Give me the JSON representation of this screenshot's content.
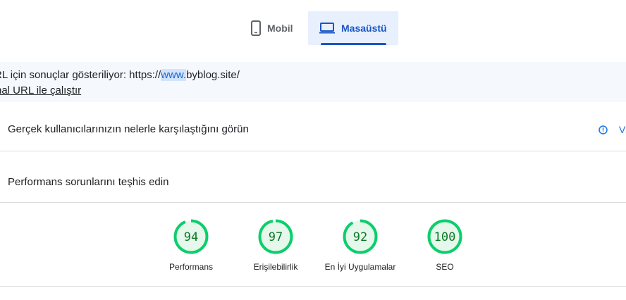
{
  "tabs": [
    {
      "label": "Mobil",
      "icon": "smartphone-icon",
      "selected": false
    },
    {
      "label": "Masaüstü",
      "icon": "laptop-icon",
      "selected": true
    }
  ],
  "url_banner": {
    "prefix": "RL için sonuçlar gösteriliyor: https://",
    "highlight": "www.",
    "suffix": "byblog.site/",
    "original_link": "ijinal URL ile çalıştır"
  },
  "field_data": {
    "heading": "Gerçek kullanıcılarınızın nelerle karşılaştığını görün",
    "info_label": "V",
    "info_icon": "info-icon"
  },
  "lab": {
    "heading": "Performans sorunlarını teşhis edin",
    "scores": [
      {
        "label": "Performans",
        "value": 94
      },
      {
        "label": "Erişilebilirlik",
        "value": 97
      },
      {
        "label": "En İyi Uygulamalar",
        "value": 92
      },
      {
        "label": "SEO",
        "value": 100
      }
    ]
  },
  "colors": {
    "accent": "#1a56c4",
    "good": "#0cce6b",
    "good_text": "#0a7a25",
    "good_bg": "#e6f7ec"
  }
}
